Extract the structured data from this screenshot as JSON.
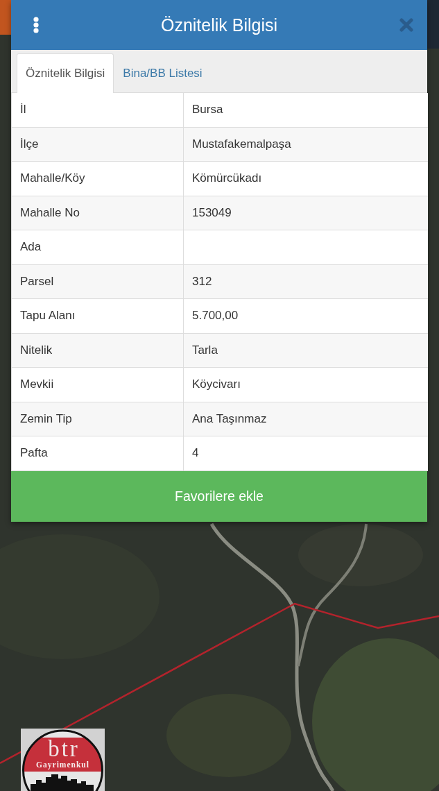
{
  "dialog": {
    "title": "Öznitelik Bilgisi"
  },
  "tabs": [
    {
      "label": "Öznitelik Bilgisi",
      "selected": true
    },
    {
      "label": "Bina/BB Listesi",
      "selected": false
    }
  ],
  "attributes": [
    {
      "label": "İl",
      "value": "Bursa"
    },
    {
      "label": "İlçe",
      "value": "Mustafakemalpaşa"
    },
    {
      "label": "Mahalle/Köy",
      "value": "Kömürcükadı"
    },
    {
      "label": "Mahalle No",
      "value": "153049"
    },
    {
      "label": "Ada"
    },
    {
      "label": "Parsel",
      "value": "312"
    },
    {
      "label": "Tapu Alanı",
      "value": "5.700,00"
    },
    {
      "label": "Nitelik",
      "value": "Tarla"
    },
    {
      "label": "Mevkii",
      "value": "Köycivarı"
    },
    {
      "label": "Zemin Tip",
      "value": "Ana Taşınmaz"
    },
    {
      "label": "Pafta",
      "value": "4"
    }
  ],
  "favorite_button": {
    "label": "Favorilere ekle"
  },
  "logo": {
    "wordmark": "btr",
    "subtitle": "Gayrimenkul"
  }
}
